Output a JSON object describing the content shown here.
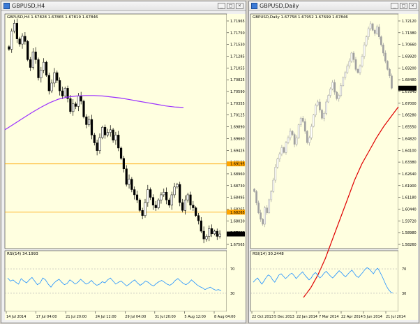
{
  "colors": {
    "chart_bg": "#ffffe0",
    "line_color": "#9f9f9f",
    "candle_color": "#000000",
    "ma_left": "#9b30ff",
    "ma_right": "#e00000",
    "level_line": "#ffa500",
    "rsi_line": "#1e90ff",
    "rsi_level": "#b0b0b0",
    "price_badge": "#000000"
  },
  "left": {
    "title": "GBPUSD,H4",
    "icon": "chart-window-icon",
    "buttons": [
      "_",
      "□",
      "×"
    ],
    "info": "GBPUSD,H4 1.67828 1.67865 1.67819 1.67846",
    "price_axis": [
      "1.71965",
      "1.71750",
      "1.71530",
      "1.71285",
      "1.71055",
      "1.70825",
      "1.70590",
      "1.70355",
      "1.70125",
      "1.69890",
      "1.69660",
      "1.69425",
      "1.69195",
      "1.68960",
      "1.68730",
      "1.68495",
      "1.68265",
      "1.68030",
      "1.67800",
      "1.67565"
    ],
    "level_labels": [
      "1.69195",
      "1.68265"
    ],
    "current_price": "1.67846",
    "rsi_label": "RSI(14) 34.1993",
    "rsi_levels": [
      "70",
      "30"
    ],
    "time_axis": [
      "14 Jul 2014",
      "17 Jul 04:00",
      "21 Jul 20:00",
      "24 Jul 12:00",
      "29 Jul 04:00",
      "31 Jul 20:00",
      "5 Aug 12:00",
      "8 Aug 04:00"
    ],
    "chart_data": {
      "type": "candlestick",
      "ylim": [
        1.67565,
        1.72079
      ],
      "levels": [
        1.69195,
        1.68265
      ],
      "ma_period": "",
      "closes": [
        1.714,
        1.7175,
        1.719,
        1.716,
        1.715,
        1.7165,
        1.7155,
        1.712,
        1.7105,
        1.7135,
        1.712,
        1.7085,
        1.71,
        1.7115,
        1.709,
        1.706,
        1.7075,
        1.7095,
        1.708,
        1.706,
        1.705,
        1.7065,
        1.7045,
        1.702,
        1.7035,
        1.703,
        1.705,
        1.704,
        1.701,
        1.6995,
        1.7005,
        1.6975,
        1.696,
        1.6945,
        1.697,
        1.699,
        1.6975,
        1.698,
        1.6985,
        1.6965,
        1.6975,
        1.695,
        1.693,
        1.691,
        1.688,
        1.689,
        1.687,
        1.686,
        1.685,
        1.683,
        1.682,
        1.6845,
        1.687,
        1.6855,
        1.684,
        1.6835,
        1.685,
        1.686,
        1.6865,
        1.685,
        1.684,
        1.686,
        1.6875,
        1.688,
        1.6845,
        1.683,
        1.685,
        1.686,
        1.684,
        1.6835,
        1.682,
        1.681,
        1.679,
        1.6775,
        1.678,
        1.6795,
        1.6785,
        1.679,
        1.678,
        1.67846
      ],
      "ma": [
        1.6985,
        1.6996,
        1.7007,
        1.7018,
        1.7028,
        1.7037,
        1.7044,
        1.7048,
        1.705,
        1.7051,
        1.7051,
        1.705,
        1.7048,
        1.7046,
        1.7043,
        1.704,
        1.7037,
        1.7034,
        1.7031,
        1.7029,
        1.7028
      ],
      "rsi": [
        55,
        50,
        52,
        48,
        45,
        54,
        50,
        47,
        52,
        56,
        50,
        44,
        47,
        55,
        52,
        45,
        40,
        46,
        50,
        53,
        48,
        44,
        46,
        52,
        49,
        45,
        48,
        53,
        49,
        45,
        47,
        51,
        46,
        43,
        45,
        49,
        47,
        52,
        55,
        50,
        45,
        48,
        50,
        46,
        42,
        45,
        49,
        52,
        47,
        43,
        46,
        50,
        48,
        44,
        42,
        46,
        49,
        51,
        48,
        45,
        43,
        46,
        51,
        54,
        50,
        46,
        44,
        47,
        52,
        48,
        44,
        41,
        39,
        36,
        38,
        40,
        37,
        35,
        36,
        34.1993
      ]
    }
  },
  "right": {
    "title": "GBPUSD,Daily",
    "icon": "chart-window-icon",
    "buttons": [
      "_",
      "□",
      "×"
    ],
    "info": "GBPUSD,Daily 1.67758 1.67952 1.67699 1.67846",
    "price_axis": [
      "1.72120",
      "1.71380",
      "1.70660",
      "1.69920",
      "1.69200",
      "1.68480",
      "1.67840",
      "1.67000",
      "1.66280",
      "1.65550",
      "1.64820",
      "1.64100",
      "1.63380",
      "1.62640",
      "1.61900",
      "1.61180",
      "1.60440",
      "1.59720",
      "1.58980",
      "1.58260"
    ],
    "current_price": "1.67846",
    "rsi_label": "RSI(14) 30.2448",
    "rsi_levels": [
      "70",
      "30"
    ],
    "time_axis": [
      "22 Oct 2013",
      "5 Dec 2013",
      "22 Jan 2014",
      "7 Mar 2014",
      "22 Apr 2014",
      "5 Jun 2014",
      "21 Jul 2014"
    ],
    "chart_data": {
      "type": "candlestick",
      "ylim": [
        1.58,
        1.724
      ],
      "ma_period": "",
      "closes": [
        1.615,
        1.608,
        1.602,
        1.598,
        1.595,
        1.605,
        1.602,
        1.61,
        1.615,
        1.622,
        1.63,
        1.635,
        1.638,
        1.642,
        1.639,
        1.645,
        1.648,
        1.652,
        1.65,
        1.644,
        1.648,
        1.656,
        1.66,
        1.658,
        1.652,
        1.645,
        1.648,
        1.655,
        1.662,
        1.668,
        1.67,
        1.665,
        1.66,
        1.663,
        1.67,
        1.674,
        1.678,
        1.682,
        1.676,
        1.672,
        1.674,
        1.68,
        1.685,
        1.688,
        1.692,
        1.695,
        1.7,
        1.696,
        1.69,
        1.688,
        1.692,
        1.698,
        1.705,
        1.71,
        1.715,
        1.718,
        1.714,
        1.712,
        1.716,
        1.71,
        1.705,
        1.7,
        1.695,
        1.69,
        1.686,
        1.67846
      ],
      "ma": [
        1.55,
        1.556,
        1.564,
        1.574,
        1.586,
        1.598,
        1.61,
        1.622,
        1.632,
        1.64,
        1.648,
        1.655,
        1.661,
        1.667
      ],
      "rsi": [
        48,
        52,
        55,
        50,
        45,
        50,
        56,
        60,
        58,
        52,
        48,
        54,
        60,
        62,
        58,
        54,
        57,
        61,
        63,
        59,
        54,
        58,
        62,
        65,
        60,
        56,
        52,
        55,
        61,
        64,
        60,
        55,
        58,
        63,
        66,
        62,
        58,
        55,
        59,
        63,
        67,
        64,
        60,
        57,
        61,
        65,
        68,
        63,
        58,
        56,
        60,
        64,
        69,
        72,
        70,
        66,
        62,
        68,
        71,
        65,
        58,
        50,
        42,
        36,
        32,
        30.2448
      ]
    }
  }
}
